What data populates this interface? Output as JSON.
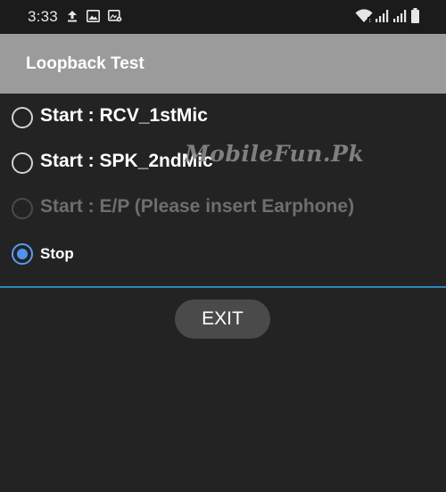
{
  "status_bar": {
    "time": "3:33",
    "left_icons": [
      "upload-icon",
      "image-icon",
      "screenshot-settings-icon"
    ],
    "right_icons": [
      "wifi-icon",
      "signal-icon",
      "signal-icon",
      "battery-icon"
    ]
  },
  "title_bar": {
    "title": "Loopback Test"
  },
  "options": [
    {
      "label": "Start : RCV_1stMic",
      "state": "unchecked",
      "enabled": true
    },
    {
      "label": "Start : SPK_2ndMic",
      "state": "unchecked",
      "enabled": true
    },
    {
      "label": "Start : E/P (Please insert Earphone)",
      "state": "unchecked",
      "enabled": false
    },
    {
      "label": "Stop",
      "state": "checked",
      "enabled": true
    }
  ],
  "exit_button": {
    "label": "EXIT"
  },
  "watermark": {
    "text": "MobileFun.Pk"
  },
  "colors": {
    "background": "#232323",
    "status_bar": "#1b1b1b",
    "title_bar": "#9b9b9b",
    "accent": "#4f93f0",
    "divider": "#2f86b9",
    "button": "#4a4a4a"
  }
}
